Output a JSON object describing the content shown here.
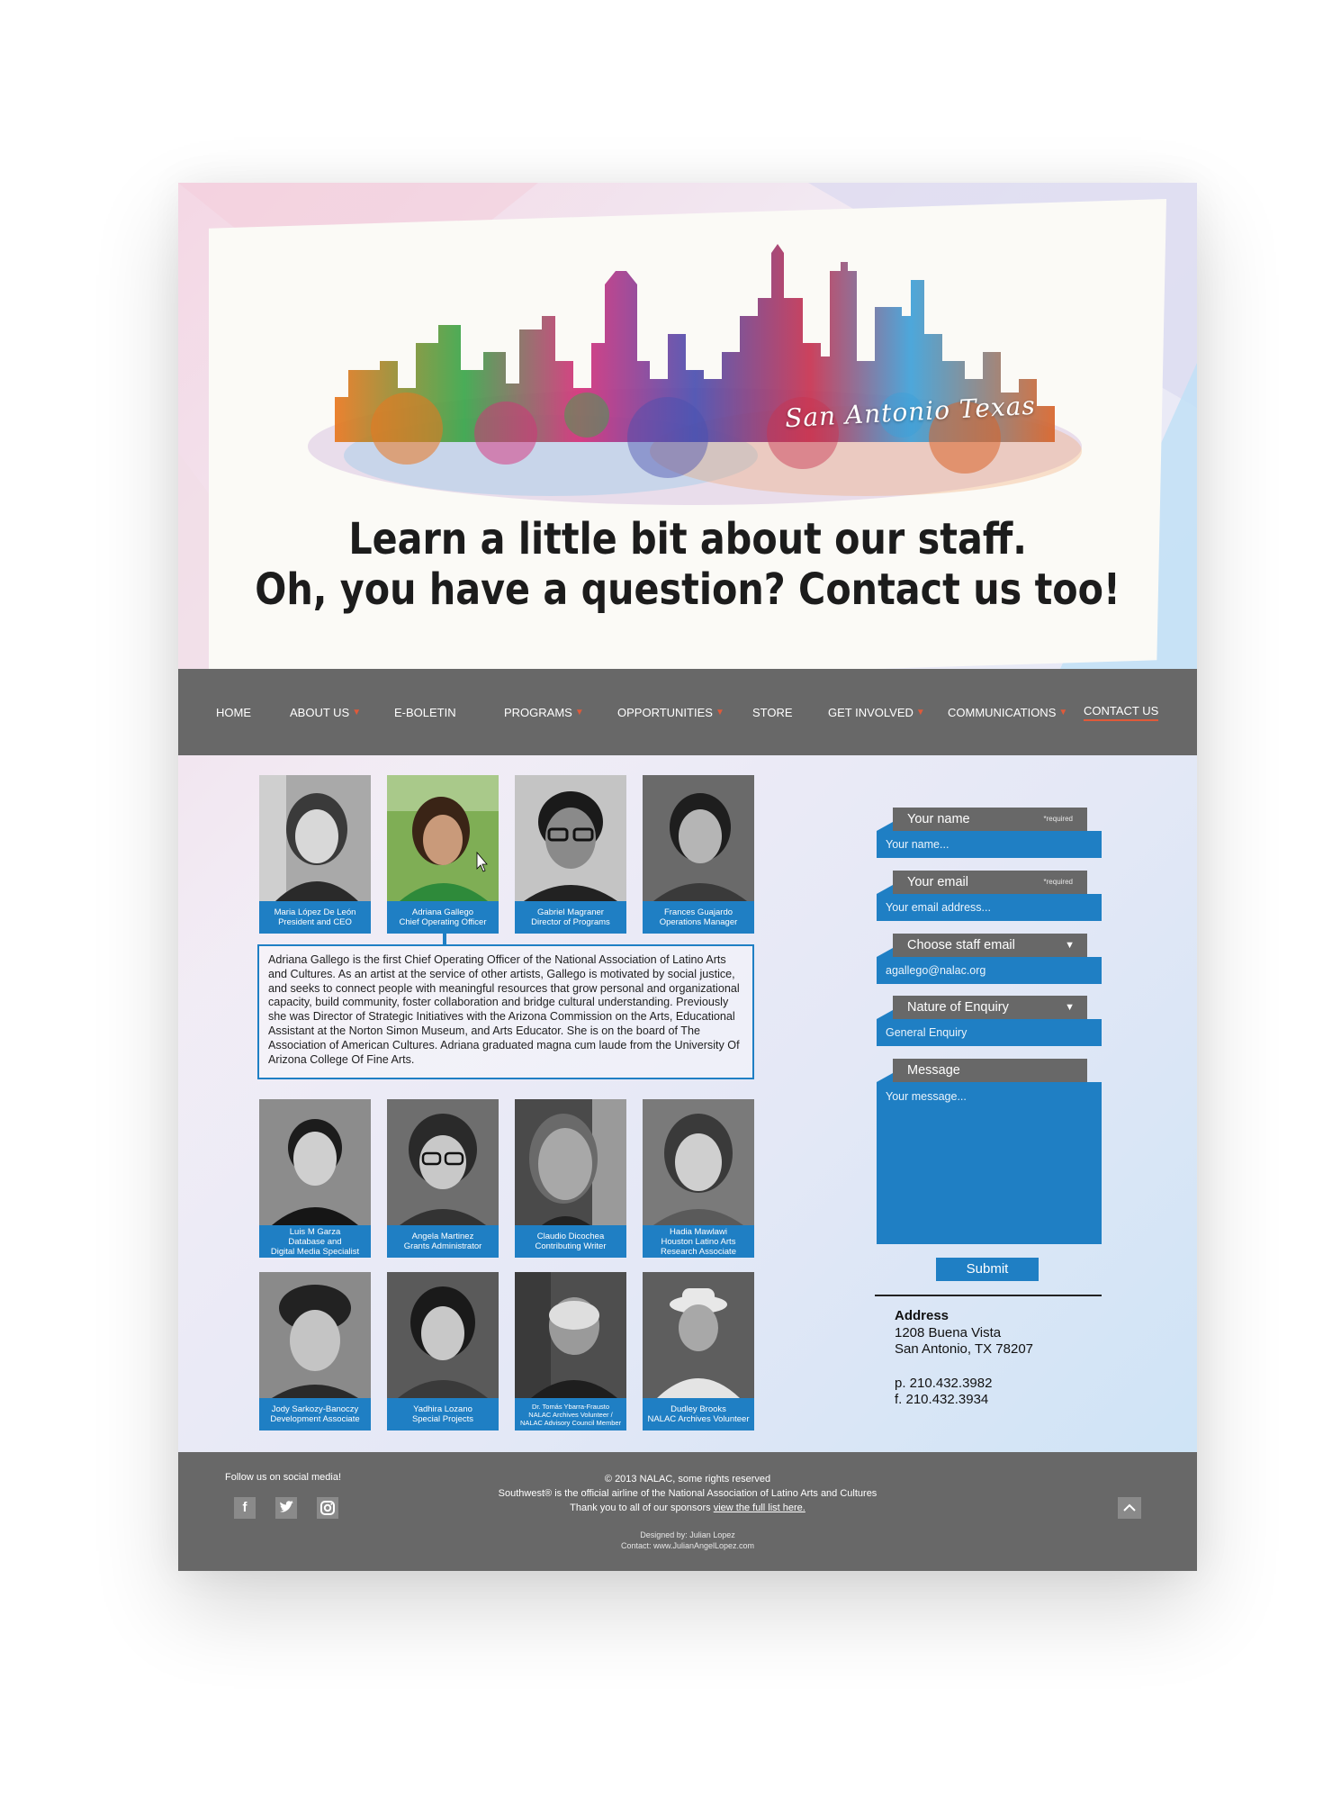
{
  "hero": {
    "city_script": "San Antonio Texas",
    "headline_line1": "Learn a little bit about our staff.",
    "headline_line2": "Oh, you have a question? Contact us too!"
  },
  "nav": {
    "items": [
      {
        "label": "HOME",
        "dropdown": false
      },
      {
        "label": "ABOUT US",
        "dropdown": true
      },
      {
        "label": "E-BOLETIN",
        "dropdown": false
      },
      {
        "label": "PROGRAMS",
        "dropdown": true
      },
      {
        "label": "OPPORTUNITIES",
        "dropdown": true
      },
      {
        "label": "STORE",
        "dropdown": false
      },
      {
        "label": "GET INVOLVED",
        "dropdown": true
      },
      {
        "label": "COMMUNICATIONS",
        "dropdown": true
      },
      {
        "label": "CONTACT US",
        "dropdown": false,
        "active": true
      }
    ],
    "caret": "▼"
  },
  "staff": [
    {
      "name": "Maria López De León",
      "title": "President and CEO"
    },
    {
      "name": "Adriana Gallego",
      "title": "Chief Operating Officer"
    },
    {
      "name": "Gabriel Magraner",
      "title": "Director of Programs"
    },
    {
      "name": "Frances Guajardo",
      "title": "Operations Manager"
    },
    {
      "name": "Luis M Garza",
      "title": "Database and",
      "title2": "Digital Media Specialist"
    },
    {
      "name": "Angela Martinez",
      "title": "Grants Administrator"
    },
    {
      "name": "Claudio Dicochea",
      "title": "Contributing Writer"
    },
    {
      "name": "Hadia Mawlawi",
      "title": "Houston Latino Arts",
      "title2": "Research Associate"
    },
    {
      "name": "Jody Sarkozy-Banoczy",
      "title": "Development Associate"
    },
    {
      "name": "Yadhira Lozano",
      "title": "Special Projects"
    },
    {
      "name": "Dr. Tomás Ybarra-Frausto",
      "title": "NALAC Archives Volunteer /",
      "title2": "NALAC Advisory Council Member"
    },
    {
      "name": "Dudley Brooks",
      "title": "NALAC Archives Volunteer"
    }
  ],
  "bio": "Adriana Gallego is the first Chief Operating Officer of the National Association of Latino Arts and Cultures. As an artist at the service of other artists, Gallego is motivated by social justice, and seeks to connect people with meaningful resources that grow personal and organizational capacity, build community, foster collaboration and bridge cultural understanding. Previously she was Director of Strategic Initiatives with the Arizona Commission on the Arts, Educational Assistant at the Norton Simon Museum, and Arts Educator. She is on the board of The Association of American Cultures. Adriana graduated magna cum laude from the University Of Arizona College Of Fine Arts.",
  "form": {
    "required_note": "*required",
    "name_label": "Your name",
    "name_placeholder": "Your name...",
    "email_label": "Your email",
    "email_placeholder": "Your email address...",
    "staff_label": "Choose staff email",
    "staff_value": "agallego@nalac.org",
    "enquiry_label": "Nature of Enquiry",
    "enquiry_value": "General Enquiry",
    "message_label": "Message",
    "message_placeholder": "Your message...",
    "dropdown_arrow": "▼",
    "submit_label": "Submit"
  },
  "address": {
    "heading": "Address",
    "line1": "1208 Buena Vista",
    "line2": "San Antonio, TX 78207",
    "phone": "p.  210.432.3982",
    "fax": "f.   210.432.3934"
  },
  "footer": {
    "follow": "Follow us on social media!",
    "social_icons": [
      "facebook-icon",
      "twitter-icon",
      "instagram-icon"
    ],
    "copyright": "© 2013 NALAC, some rights reserved",
    "airline": "Southwest® is the official airline of the National Association of Latino Arts and Cultures",
    "thanks": "Thank you to all of our sponsors",
    "sponsors_link": "view the full list here.",
    "designed_by": "Designed by: Julian Lopez",
    "contact": "Contact: www.JulianAngelLopez.com"
  },
  "colors": {
    "accent_blue": "#1f7fc4",
    "nav_gray": "#686868",
    "caret_orange": "#e05a3a"
  }
}
